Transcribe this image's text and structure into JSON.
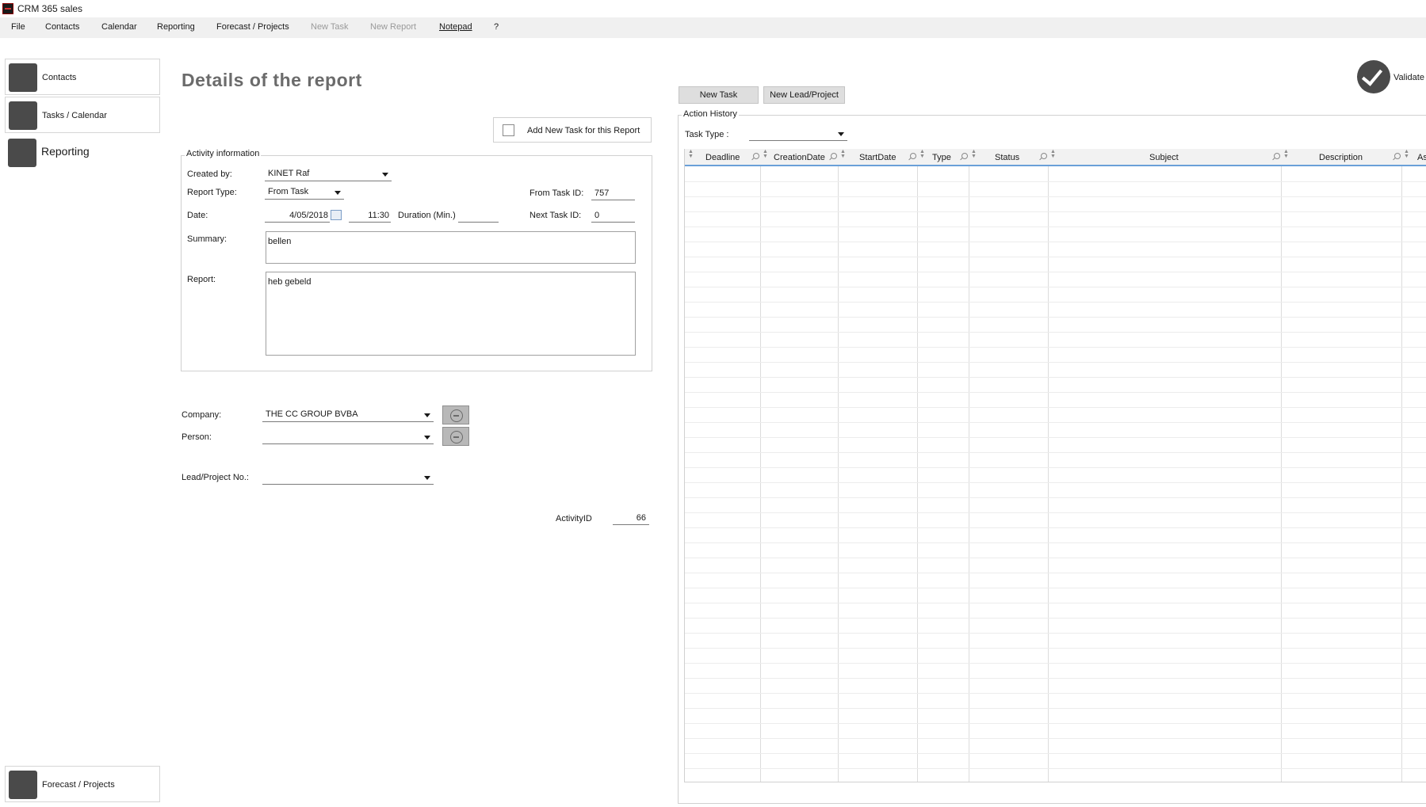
{
  "window": {
    "title": "CRM 365 sales"
  },
  "menu": {
    "items": [
      {
        "label": "File"
      },
      {
        "label": "Contacts"
      },
      {
        "label": "Calendar"
      },
      {
        "label": "Reporting"
      },
      {
        "label": "Forecast / Projects"
      },
      {
        "label": "New Task"
      },
      {
        "label": "New Report"
      },
      {
        "label": "Notepad"
      },
      {
        "label": "?"
      }
    ]
  },
  "sidebar": {
    "contacts": "Contacts",
    "tasks": "Tasks / Calendar",
    "reporting": "Reporting",
    "forecast": "Forecast / Projects"
  },
  "page": {
    "title": "Details of  the report"
  },
  "add_task": {
    "label": "Add New Task for this Report",
    "checked": false
  },
  "activity": {
    "group_title": "Activity information",
    "created_by_label": "Created by:",
    "created_by_value": "KINET Raf",
    "report_type_label": "Report Type:",
    "report_type_value": "From Task",
    "date_label": "Date:",
    "date_value": "4/05/2018",
    "time_value": "11:30",
    "duration_label": "Duration (Min.)",
    "duration_value": "",
    "from_task_label": "From Task ID:",
    "from_task_value": "757",
    "next_task_label": "Next Task ID:",
    "next_task_value": "0",
    "summary_label": "Summary:",
    "summary_value": "bellen",
    "report_label": "Report:",
    "report_value": "heb gebeld"
  },
  "company": {
    "label": "Company:",
    "value": "THE CC GROUP BVBA"
  },
  "person": {
    "label": "Person:",
    "value": ""
  },
  "lead": {
    "label": "Lead/Project No.:",
    "value": ""
  },
  "activity_id": {
    "label": "ActivityID",
    "value": "66"
  },
  "right": {
    "new_task_button": "New Task",
    "new_lead_button": "New Lead/Project",
    "validate_label": "Validate",
    "action_history_title": "Action History",
    "task_type_label": "Task Type :",
    "task_type_value": "",
    "columns": [
      "Deadline",
      "CreationDate",
      "StartDate",
      "Type",
      "Status",
      "Subject",
      "Description",
      "As"
    ]
  }
}
